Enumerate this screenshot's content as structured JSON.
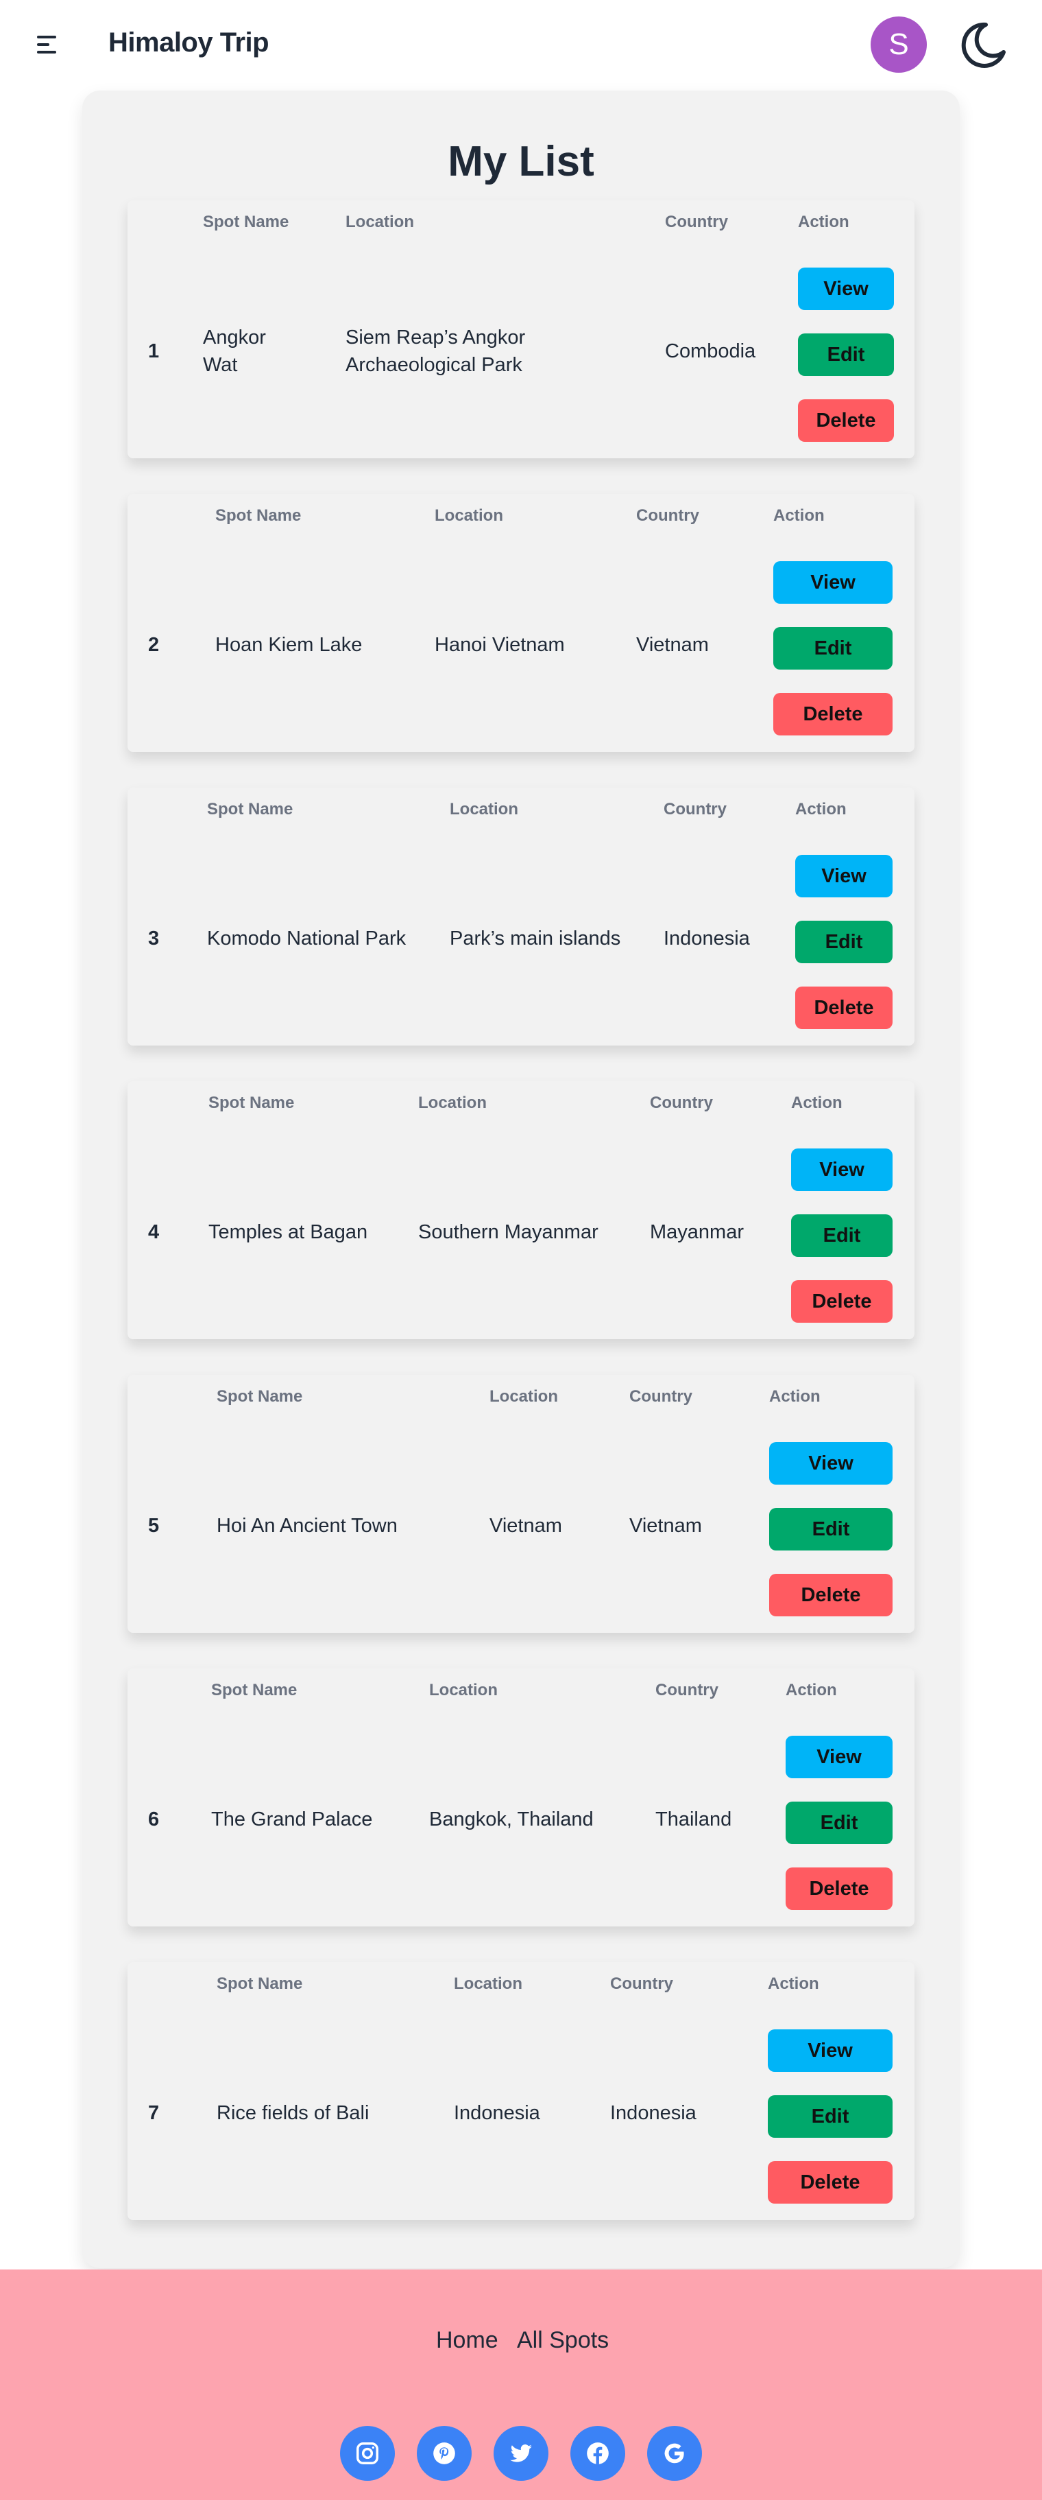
{
  "navbar": {
    "brand": "Himaloy Trip",
    "avatar_initial": "S",
    "menu_icon": "hamburger-menu-icon",
    "theme_icon": "moon-icon"
  },
  "main": {
    "title": "My List",
    "headers": {
      "spot_name": "Spot Name",
      "location": "Location",
      "country": "Country",
      "action": "Action"
    },
    "buttons": {
      "view": "View",
      "edit": "Edit",
      "delete": "Delete"
    },
    "rows": [
      {
        "num": "1",
        "spot_name": "Angkor Wat",
        "location": "Siem Reap’s Angkor Archaeological Park",
        "country": "Combodia"
      },
      {
        "num": "2",
        "spot_name": "Hoan Kiem Lake",
        "location": "Hanoi Vietnam",
        "country": "Vietnam"
      },
      {
        "num": "3",
        "spot_name": "Komodo National Park",
        "location": "Park’s main islands",
        "country": "Indonesia"
      },
      {
        "num": "4",
        "spot_name": "Temples at Bagan",
        "location": "Southern Mayanmar",
        "country": "Mayanmar"
      },
      {
        "num": "5",
        "spot_name": "Hoi An Ancient Town",
        "location": "Vietnam",
        "country": "Vietnam"
      },
      {
        "num": "6",
        "spot_name": "The Grand Palace",
        "location": "Bangkok, Thailand",
        "country": "Thailand"
      },
      {
        "num": "7",
        "spot_name": "Rice fields of Bali",
        "location": "Indonesia",
        "country": "Indonesia"
      }
    ]
  },
  "footer": {
    "links": [
      "Home",
      "All Spots"
    ],
    "social_icons": [
      "instagram-icon",
      "pinterest-icon",
      "twitter-icon",
      "facebook-icon",
      "google-icon"
    ]
  },
  "colors": {
    "view": "#00b4f7",
    "edit": "#00a86b",
    "delete": "#ff5b61",
    "avatar": "#a855c7",
    "footer": "#fda4af",
    "social": "#3b82f6"
  }
}
